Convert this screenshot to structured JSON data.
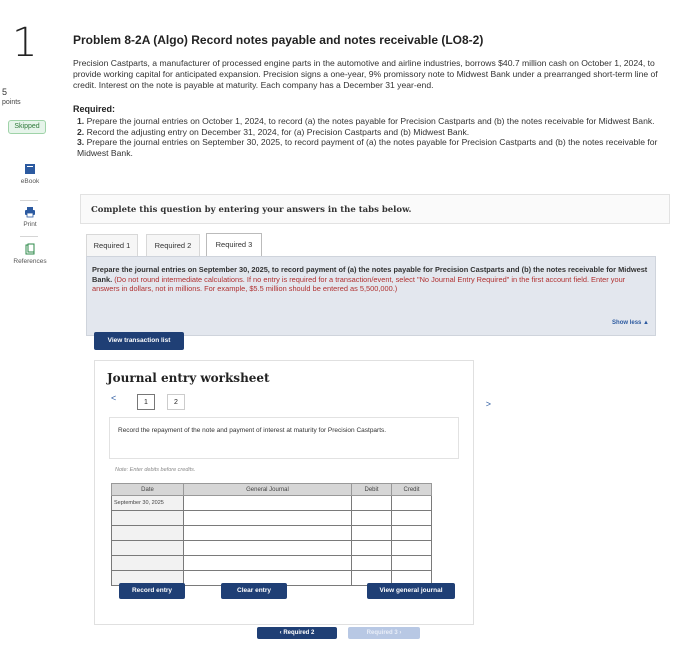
{
  "rail": {
    "question_number": "1",
    "points_value": "5",
    "points_label": "points",
    "status_badge": "Skipped",
    "tools": [
      {
        "label": "eBook",
        "icon": "ebook-icon"
      },
      {
        "label": "Print",
        "icon": "print-icon"
      },
      {
        "label": "References",
        "icon": "references-icon"
      }
    ]
  },
  "problem": {
    "title": "Problem 8-2A (Algo) Record notes payable and notes receivable (LO8-2)",
    "intro": "Precision Castparts, a manufacturer of processed engine parts in the automotive and airline industries, borrows $40.7 million cash on October 1, 2024, to provide working capital for anticipated expansion. Precision signs a one-year, 9% promissory note to Midwest Bank under a prearranged short-term line of credit. Interest on the note is payable at maturity. Each company has a December 31 year-end.",
    "required_heading": "Required:",
    "required_items": [
      {
        "num": "1.",
        "text": "Prepare the journal entries on October 1, 2024, to record (a) the notes payable for Precision Castparts and (b) the notes receivable for Midwest Bank."
      },
      {
        "num": "2.",
        "text": "Record the adjusting entry on December 31, 2024, for (a) Precision Castparts and (b) Midwest Bank."
      },
      {
        "num": "3.",
        "text": "Prepare the journal entries on September 30, 2025, to record payment of (a) the notes payable for Precision Castparts and (b) the notes receivable for Midwest Bank."
      }
    ]
  },
  "complete_banner": "Complete this question by entering your answers in the tabs below.",
  "tabs": [
    {
      "label": "Required 1"
    },
    {
      "label": "Required 2"
    },
    {
      "label": "Required 3"
    }
  ],
  "task": {
    "bold_text": "Prepare the journal entries on September 30, 2025, to record payment of (a) the notes payable for Precision Castparts and (b) the notes receivable for Midwest Bank.",
    "red_text": "(Do not round intermediate calculations. If no entry is required for a transaction/event, select \"No Journal Entry Required\" in the first account field. Enter your answers in dollars, not in millions. For example, $5.5 million should be entered as 5,500,000.)",
    "show_less": "Show less ▲"
  },
  "view_transaction_list": "View transaction list",
  "worksheet": {
    "title": "Journal entry worksheet",
    "pages": [
      "1",
      "2"
    ],
    "description": "Record the repayment of the note and payment of interest at maturity for Precision Castparts.",
    "note": "Note: Enter debits before credits.",
    "columns": [
      "Date",
      "General Journal",
      "Debit",
      "Credit"
    ],
    "rows": [
      {
        "date": "September 30, 2025",
        "account": "",
        "debit": "",
        "credit": ""
      },
      {
        "date": "",
        "account": "",
        "debit": "",
        "credit": ""
      },
      {
        "date": "",
        "account": "",
        "debit": "",
        "credit": ""
      },
      {
        "date": "",
        "account": "",
        "debit": "",
        "credit": ""
      },
      {
        "date": "",
        "account": "",
        "debit": "",
        "credit": ""
      },
      {
        "date": "",
        "account": "",
        "debit": "",
        "credit": ""
      }
    ],
    "record_entry": "Record entry",
    "clear_entry": "Clear entry",
    "view_general_journal": "View general journal"
  },
  "nav": {
    "prev": "‹ Required 2",
    "next": "Required 3 ›"
  },
  "colors": {
    "primary_button": "#1f3f75",
    "task_box_bg": "#e3e7ee",
    "red_instruction": "#b03030",
    "link_blue": "#2c5aa0"
  }
}
